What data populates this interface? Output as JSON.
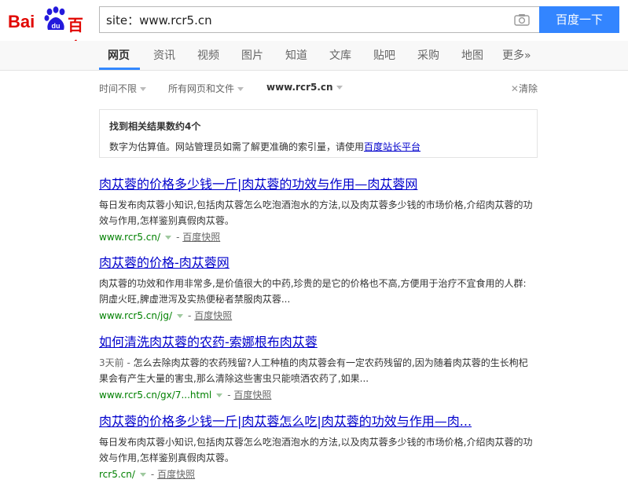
{
  "header": {
    "logo_text_left": "Bai",
    "logo_text_paw": "du",
    "logo_text_right": "百度",
    "search_value": "site：www.rcr5.cn",
    "search_button": "百度一下",
    "camera_icon": "camera-icon"
  },
  "nav": {
    "items": [
      "网页",
      "资讯",
      "视频",
      "图片",
      "知道",
      "文库",
      "贴吧",
      "采购",
      "地图",
      "更多»"
    ],
    "active_index": 0
  },
  "filters": {
    "time": "时间不限",
    "type": "所有网页和文件",
    "site": "www.rcr5.cn",
    "clear": "清除"
  },
  "info": {
    "title": "找到相关结果数约4个",
    "text_before": "数字为估算值。网站管理员如需了解更准确的索引量，请使用",
    "link": "百度站长平台"
  },
  "results": [
    {
      "title": "肉苁蓉的价格多少钱一斤|肉苁蓉的功效与作用—肉苁蓉网",
      "date": "",
      "abstract": "每日发布肉苁蓉小知识,包括肉苁蓉怎么吃泡酒泡水的方法,以及肉苁蓉多少钱的市场价格,介绍肉苁蓉的功效与作用,怎样鉴别真假肉苁蓉。",
      "url": "www.rcr5.cn/",
      "snapshot": "百度快照"
    },
    {
      "title": "肉苁蓉的价格-肉苁蓉网",
      "date": "",
      "abstract": "肉苁蓉的功效和作用非常多,是价值很大的中药,珍贵的是它的价格也不高,方便用于治疗不宜食用的人群:阴虚火旺,脾虚泄泻及实热便秘者禁服肉苁蓉...",
      "url": "www.rcr5.cn/jg/",
      "snapshot": "百度快照"
    },
    {
      "title": "如何清洗肉苁蓉的农药-索娜根布肉苁蓉",
      "date": "3天前 - ",
      "abstract": "怎么去除肉苁蓉的农药残留?人工种植的肉苁蓉会有一定农药残留的,因为随着肉苁蓉的生长枸杞果会有产生大量的害虫,那么清除这些害虫只能喷洒农药了,如果...",
      "url": "www.rcr5.cn/gx/7...html",
      "snapshot": "百度快照"
    },
    {
      "title": "肉苁蓉的价格多少钱一斤|肉苁蓉怎么吃|肉苁蓉的功效与作用—肉...",
      "date": "",
      "abstract": "每日发布肉苁蓉小知识,包括肉苁蓉怎么吃泡酒泡水的方法,以及肉苁蓉多少钱的市场价格,介绍肉苁蓉的功效与作用,怎样鉴别真假肉苁蓉。",
      "url": "rcr5.cn/",
      "snapshot": "百度快照"
    }
  ],
  "colors": {
    "link": "#0000cc",
    "url": "#008000",
    "button": "#3385ff",
    "brand_red": "#e10601",
    "brand_blue": "#2319dc"
  }
}
